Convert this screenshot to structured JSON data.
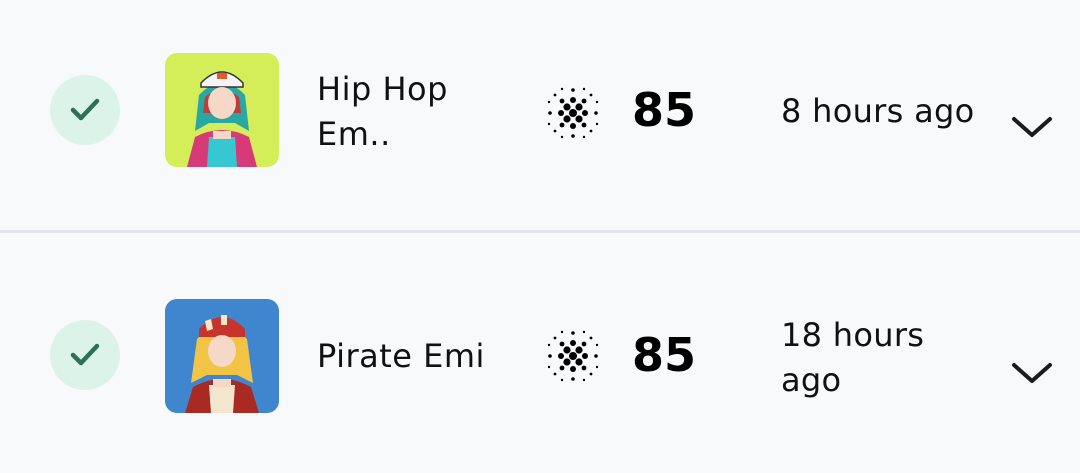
{
  "items": [
    {
      "name": "Hip Hop Em..",
      "score": "85",
      "time": "8 hours ago",
      "status_icon": "check-icon",
      "avatar_bg": "#d4ee5a"
    },
    {
      "name": "Pirate Emi",
      "score": "85",
      "time": "18 hours ago",
      "status_icon": "check-icon",
      "avatar_bg": "#3f86cf"
    }
  ],
  "colors": {
    "check_bg": "#dcf3ea",
    "check_mark": "#2e6f57",
    "divider": "#e3e5ea",
    "background": "#f8f9fb"
  },
  "icons": [
    "check-icon",
    "cardano-icon",
    "chevron-down-icon"
  ]
}
